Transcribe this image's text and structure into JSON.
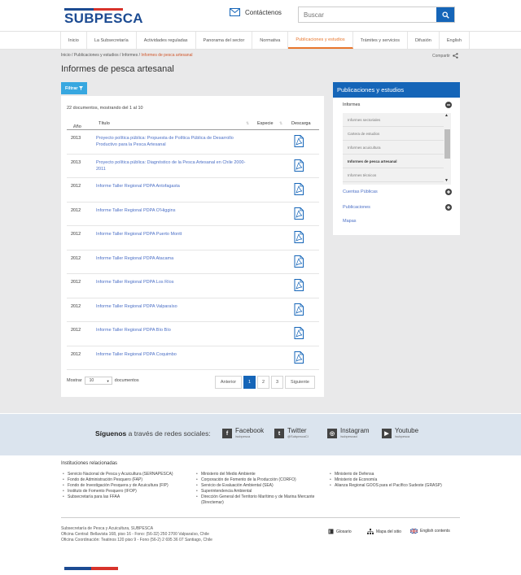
{
  "header": {
    "logo_text": "SUBPESCA",
    "contact_label": "Contáctenos",
    "search_placeholder": "Buscar"
  },
  "nav": {
    "items": [
      "Inicio",
      "La Subsecretaría",
      "Actividades reguladas",
      "Panorama del sector",
      "Normativa",
      "Publicaciones y estudios",
      "Trámites y servicios",
      "Difusión",
      "English"
    ],
    "active_index": 5
  },
  "breadcrumb": {
    "path": "Inicio / Publicaciones y estudios / Informes / ",
    "current": "Informes de pesca artesanal"
  },
  "share_label": "Compartir",
  "page_title": "Informes de pesca artesanal",
  "filter_label": "Filtrar",
  "table": {
    "count_text": "22 documentos, mostrando del 1 al 10",
    "headers": {
      "year": "Año",
      "title": "Título",
      "species": "Especie",
      "download": "Descarga"
    },
    "rows": [
      {
        "year": "2013",
        "title": "Proyecto política pública: Propuesta de Política Pública de Desarrollo Productivo para la Pesca Artesanal"
      },
      {
        "year": "2013",
        "title": "Proyecto política pública: Diagnóstico de la Pesca Artesanal en Chile 2000-2011"
      },
      {
        "year": "2012",
        "title": "Informe Taller Regional PDPA Antofagasta"
      },
      {
        "year": "2012",
        "title": "Informe Taller Regional PDPA O'Higgins"
      },
      {
        "year": "2012",
        "title": "Informe Taller Regional PDPA Puerto Montt"
      },
      {
        "year": "2012",
        "title": "Informe Taller Regional PDPA Atacama"
      },
      {
        "year": "2012",
        "title": "Informe Taller Regional PDPA Los Ríos"
      },
      {
        "year": "2012",
        "title": "Informe Taller Regional PDPA Valparaíso"
      },
      {
        "year": "2012",
        "title": "Informe Taller Regional PDPA Bío Bío"
      },
      {
        "year": "2012",
        "title": "Informe Taller Regional PDPA Coquimbo"
      }
    ],
    "show_label": "Mostrar",
    "show_value": "10",
    "show_suffix": "documentos"
  },
  "pagination": {
    "prev": "Anterior",
    "pages": [
      "1",
      "2",
      "3"
    ],
    "next": "Siguiente",
    "current": "1"
  },
  "sidebar": {
    "title": "Publicaciones y estudios",
    "group": "Informes",
    "sub_items": [
      "Informes sectoriales",
      "Cartera de estudios",
      "Informes acuicultura",
      "Informes de pesca artesanal",
      "Informes técnicos"
    ],
    "active_sub": "Informes de pesca artesanal",
    "items": [
      "Cuentas Públicas",
      "Publicaciones",
      "Mapas"
    ]
  },
  "social": {
    "lead_bold": "Síguenos",
    "lead_rest": " a través de redes sociales:",
    "networks": [
      {
        "name": "Facebook",
        "handle": "/subpesca",
        "icon": "facebook-icon"
      },
      {
        "name": "Twitter",
        "handle": "@SubpescaCl",
        "icon": "twitter-icon"
      },
      {
        "name": "Instagram",
        "handle": "/subpescacl",
        "icon": "instagram-icon"
      },
      {
        "name": "Youtube",
        "handle": "/subpesca",
        "icon": "youtube-icon"
      }
    ]
  },
  "footer": {
    "institutions_title": "Instituciones relacionadas",
    "col1": [
      "Servicio Nacional de Pesca y Acuicultura (SERNAPESCA)",
      "Fondo de Administración Pesquero (FAP)",
      "Fondo de Investigación Pesquera y de Acuicultura (FIP)",
      "Instituto de Fomento Pesquero (IFOP)",
      "Subsecretaría para las FFAA"
    ],
    "col2": [
      "Ministerio del Medio Ambiente",
      "Corporación de Fomento de la Producción (CORFO)",
      "Servicio de Evaluación Ambiental (SEA)",
      "Superintendencia Ambiental",
      "Dirección General del Territorio Marítimo y de Marina Mercante (Directemar)"
    ],
    "col3": [
      "Ministerio de Defensa",
      "Ministerio de Economía",
      "Alianza Regional GOOS para el Pacífico Sudeste (GRASP)"
    ],
    "address": [
      "Subsecretaría de Pesca y Acuicultura, SUBPESCA",
      "Oficina Central: Bellavista 168, piso 16 - Fono: (56-32) 250 2700 Valparaíso, Chile",
      "Oficina Coordinación: Teatinos 120 piso 9 - Fono (56-2) 2 695 36 07 Santiago, Chile"
    ],
    "links": [
      "Glosario",
      "Mapa del sitio",
      "English contents"
    ]
  }
}
